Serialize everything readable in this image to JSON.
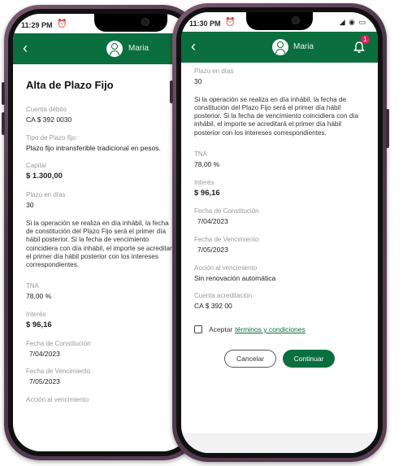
{
  "back_phone": {
    "status": {
      "time": "11:29 PM",
      "alarm_icon": "alarm-icon"
    },
    "header": {
      "back_icon": "chevron-left-icon",
      "user_name": "Maria"
    },
    "title": "Alta de Plazo Fijo",
    "fields": [
      {
        "label": "Cuenta débito",
        "value": "CA $ 392 0030"
      },
      {
        "label": "Tipo de Plazo fijo",
        "value": "Plazo fijo intransferible tradicional en pesos."
      },
      {
        "label": "Capital",
        "value": "$ 1.300,00"
      },
      {
        "label": "Plazo en días",
        "value": "30"
      }
    ],
    "info_text": "Si la operación se realiza en día inhábil, la fecha de constitución del Plazo Fijo será el primer día hábil posterior. Si la fecha de vencimiento coincidiera con día inhábil, el importe se acreditará el primer día hábil posterior con los intereses correspondientes.",
    "fields2": [
      {
        "label": "TNA",
        "value": "78,00 %"
      },
      {
        "label": "Interés",
        "value": "$ 96,16"
      },
      {
        "label": "Fecha de Constitución",
        "value": "7/04/2023"
      },
      {
        "label": "Fecha de Vencimiento",
        "value": "7/05/2023"
      },
      {
        "label": "Acción al vencimiento",
        "value": ""
      }
    ]
  },
  "front_phone": {
    "status": {
      "time": "11:30 PM",
      "alarm_icon": "alarm-icon",
      "right_icons": "◢ ◉ ▭"
    },
    "header": {
      "back_icon": "chevron-left-icon",
      "user_name": "Maria",
      "notification_count": "1"
    },
    "field_top": {
      "label": "Plazo en días",
      "value": "30"
    },
    "info_text": "Si la operación se realiza en día inhábil, la fecha de constitución del Plazo Fijo será el primer día hábil posterior. Si la fecha de vencimiento coincidiera con día inhábil, el importe se acreditará el primer día hábil posterior con los intereses correspondientes.",
    "fields": [
      {
        "label": "TNA",
        "value": "78,00 %"
      },
      {
        "label": "Interés",
        "value": "$ 96,16"
      },
      {
        "label": "Fecha de Constitución",
        "value": "7/04/2023"
      },
      {
        "label": "Fecha de Vencimiento",
        "value": "7/05/2023"
      },
      {
        "label": "Acción al vencimiento",
        "value": "Sin renovación automática"
      },
      {
        "label": "Cuenta acreditación",
        "value": "CA $ 392 00"
      }
    ],
    "terms": {
      "prefix": "Aceptar",
      "link": "términos y condiciones"
    },
    "buttons": {
      "cancel": "Cancelar",
      "continue": "Continuar"
    }
  },
  "colors": {
    "brand_green": "#0b6e3f",
    "frame": "#5c3f55",
    "badge": "#e0245e"
  }
}
